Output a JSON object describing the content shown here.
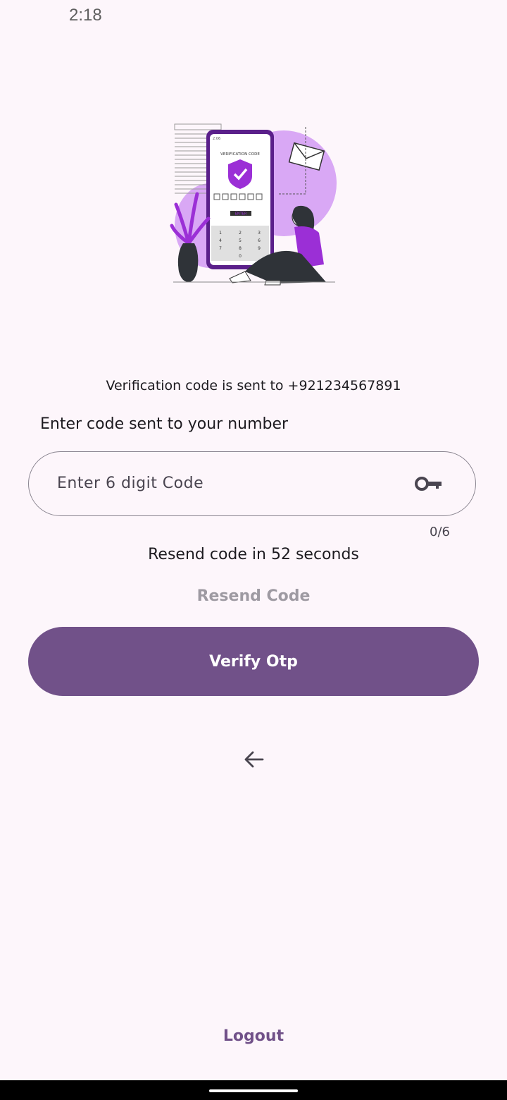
{
  "status_bar": {
    "time": "2:18"
  },
  "illustration": {
    "caption": "VERIFICATION CODE",
    "phone_button": "ENTER",
    "phone_time": "2:06",
    "keypad": [
      "1",
      "2",
      "3",
      "4",
      "5",
      "6",
      "7",
      "8",
      "9",
      "0"
    ],
    "accent_color": "#9b2fd6"
  },
  "verification_message": "Verification code is sent to +921234567891",
  "code_input": {
    "label": "Enter code sent to your number",
    "placeholder": "Enter 6 digit Code",
    "counter": "0/6",
    "icon": "key-icon"
  },
  "resend": {
    "timer_text": "Resend code in 52 seconds",
    "button_label": "Resend Code"
  },
  "verify_button": {
    "label": "Verify Otp",
    "color": "#715189"
  },
  "back": {
    "icon": "arrow-left-icon"
  },
  "logout": {
    "label": "Logout"
  }
}
